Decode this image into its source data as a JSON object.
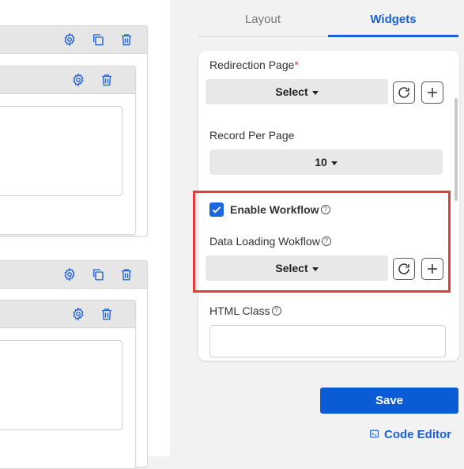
{
  "tabs": [
    {
      "label": "Layout",
      "active": false
    },
    {
      "label": "Widgets",
      "active": true
    }
  ],
  "form": {
    "redirection_page": {
      "label": "Redirection Page",
      "required_mark": "*",
      "value": "Select"
    },
    "record_per_page": {
      "label": "Record Per Page",
      "value": "10"
    },
    "enable_workflow": {
      "label": "Enable Workflow",
      "checked": true
    },
    "data_loading_workflow": {
      "label": "Data Loading Wokflow",
      "value": "Select"
    },
    "html_class": {
      "label": "HTML Class",
      "value": ""
    }
  },
  "actions": {
    "save_label": "Save",
    "code_editor_label": "Code Editor"
  },
  "colors": {
    "accent": "#1a5fd4",
    "save_button": "#0b5bd6",
    "highlight_border": "#e23b3b",
    "required": "#e03a3a",
    "checkbox": "#1a66e0"
  },
  "icons": {
    "card_toolbar": [
      "gear-icon",
      "copy-icon",
      "trash-icon"
    ],
    "inner_toolbar": [
      "gear-icon",
      "trash-icon"
    ],
    "field_actions": [
      "refresh-icon",
      "plus-icon"
    ]
  }
}
